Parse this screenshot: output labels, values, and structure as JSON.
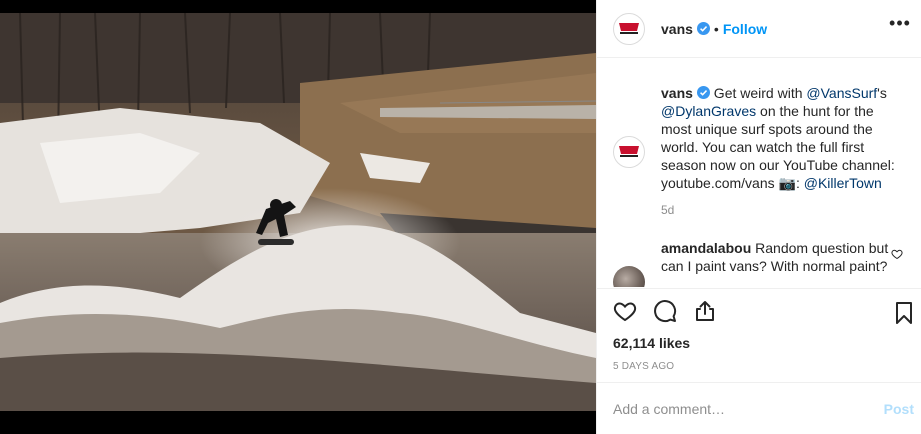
{
  "photo": {
    "icon": "surf-photo"
  },
  "header": {
    "avatar_logo_text": "VANS",
    "username": "vans",
    "dot": "•",
    "follow_label": "Follow",
    "more_label": "•••"
  },
  "caption": {
    "username": "vans",
    "part1": " Get weird with ",
    "mention1": "@VansSurf",
    "part2": "'s ",
    "mention2": "@DylanGraves",
    "part3": " on the hunt for the most unique surf spots around the world. You can watch the full first season now on our YouTube channel: youtube.com/vans 📷: ",
    "mention3": "@KillerTown",
    "age": "5d"
  },
  "reply": {
    "username": "amandalabou",
    "text": " Random question but can I paint vans? With normal paint?"
  },
  "actions": {
    "likes": "62,114 likes",
    "date": "5 DAYS AGO"
  },
  "add_comment": {
    "placeholder": "Add a comment…",
    "post_label": "Post"
  },
  "colors": {
    "accent": "#0095f6",
    "mention": "#00376b",
    "muted": "#8e8e8e",
    "verified": "#3897f0",
    "post_disabled": "#b2dffc"
  }
}
